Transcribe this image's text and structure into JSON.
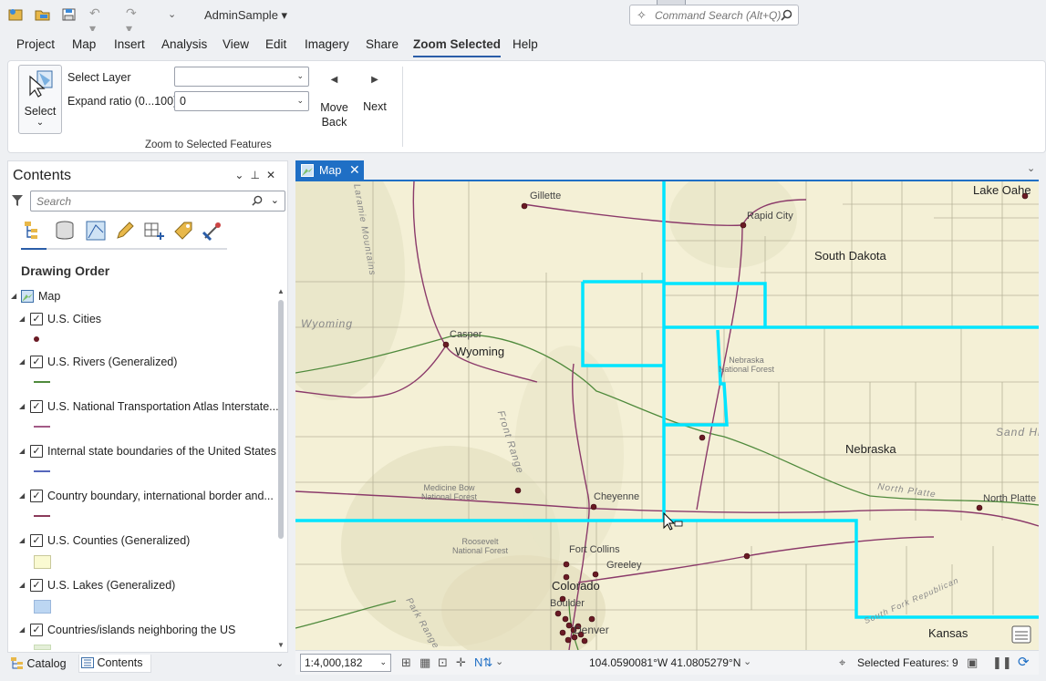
{
  "app": {
    "project_name": "AdminSample ▾",
    "command_search_placeholder": "Command Search (Alt+Q)"
  },
  "ribbon_tabs": [
    "Project",
    "Map",
    "Insert",
    "Analysis",
    "View",
    "Edit",
    "Imagery",
    "Share",
    "Zoom Selected",
    "Help"
  ],
  "active_tab": "Zoom Selected",
  "ribbon": {
    "select_label": "Select",
    "select_layer_label": "Select Layer",
    "select_layer_value": "",
    "expand_ratio_label": "Expand ratio (0...100)",
    "expand_ratio_value": "0",
    "move_back_label": "Move\nBack",
    "next_label": "Next",
    "group_label": "Zoom to Selected Features"
  },
  "contents": {
    "title": "Contents",
    "search_placeholder": "Search",
    "section_title": "Drawing Order",
    "map_label": "Map",
    "layers": [
      {
        "name": "U.S. Cities",
        "checked": true,
        "symbol": "point"
      },
      {
        "name": "U.S. Rivers (Generalized)",
        "checked": true,
        "symbol": "line-green"
      },
      {
        "name": "U.S. National Transportation Atlas Interstate...",
        "checked": true,
        "symbol": "line-purple"
      },
      {
        "name": "Internal state boundaries of the United States",
        "checked": true,
        "symbol": "line-blue"
      },
      {
        "name": "Country boundary, international border and...",
        "checked": true,
        "symbol": "line-maroon"
      },
      {
        "name": "U.S. Counties (Generalized)",
        "checked": true,
        "symbol": "fill-yellow"
      },
      {
        "name": "U.S. Lakes (Generalized)",
        "checked": true,
        "symbol": "fill-blue"
      },
      {
        "name": "Countries/islands neighboring the US",
        "checked": true,
        "symbol": "fill-green"
      }
    ],
    "bottom_tabs": [
      "Catalog",
      "Contents"
    ]
  },
  "map_view": {
    "tab_label": "Map",
    "labels": {
      "gillette": "Gillette",
      "rapid_city": "Rapid City",
      "lake_oahe": "Lake Oahe",
      "south_dakota": "South Dakota",
      "wyoming_faint": "Wyoming",
      "casper": "Casper",
      "wyoming": "Wyoming",
      "nebraska_nf": "Nebraska\nNational Forest",
      "front_range": "Front Range",
      "nebraska": "Nebraska",
      "sand_hills": "Sand Hi",
      "medicine_bow": "Medicine Bow\nNational Forest",
      "cheyenne": "Cheyenne",
      "north_platte_river": "North Platte",
      "north_platte_city": "North Platte",
      "roosevelt": "Roosevelt\nNational Forest",
      "fort_collins": "Fort Collins",
      "greeley": "Greeley",
      "colorado": "Colorado",
      "boulder": "Boulder",
      "denver": "Denver",
      "kansas": "Kansas",
      "laramie_mountains": "Laramie Mountains",
      "park_range": "Park Range",
      "south_fork_republican": "South Fork Republican"
    }
  },
  "status": {
    "scale": "1:4,000,182",
    "coordinates": "104.0590081°W 41.0805279°N",
    "selected_features": "Selected Features: 9"
  },
  "colors": {
    "accent": "#1f6fc5",
    "selection": "#00e5ff",
    "county_fill": "#f4f0d6",
    "river": "#4f8a3c",
    "interstate": "#8b3a6a"
  }
}
